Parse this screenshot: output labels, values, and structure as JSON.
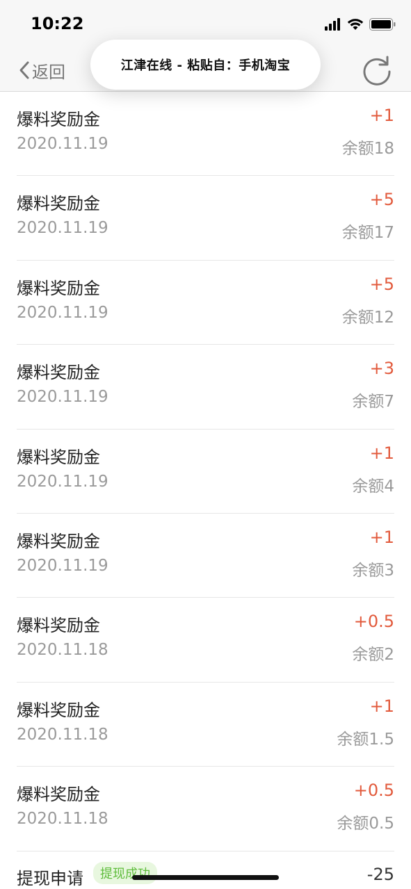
{
  "status_bar": {
    "time": "10:22"
  },
  "nav": {
    "back_label": "返回",
    "toast_text": "江津在线 - 粘贴自：手机淘宝"
  },
  "records": [
    {
      "title": "爆料奖励金",
      "date": "2020.11.19",
      "amount": "+1",
      "balance": "余额18"
    },
    {
      "title": "爆料奖励金",
      "date": "2020.11.19",
      "amount": "+5",
      "balance": "余额17"
    },
    {
      "title": "爆料奖励金",
      "date": "2020.11.19",
      "amount": "+5",
      "balance": "余额12"
    },
    {
      "title": "爆料奖励金",
      "date": "2020.11.19",
      "amount": "+3",
      "balance": "余额7"
    },
    {
      "title": "爆料奖励金",
      "date": "2020.11.19",
      "amount": "+1",
      "balance": "余额4"
    },
    {
      "title": "爆料奖励金",
      "date": "2020.11.19",
      "amount": "+1",
      "balance": "余额3"
    },
    {
      "title": "爆料奖励金",
      "date": "2020.11.18",
      "amount": "+0.5",
      "balance": "余额2"
    },
    {
      "title": "爆料奖励金",
      "date": "2020.11.18",
      "amount": "+1",
      "balance": "余额1.5"
    },
    {
      "title": "爆料奖励金",
      "date": "2020.11.18",
      "amount": "+0.5",
      "balance": "余额0.5"
    }
  ],
  "withdraw": {
    "title": "提现申请",
    "badge": "提现成功",
    "amount": "-25"
  },
  "colors": {
    "amount_positive": "#e25a3c",
    "badge_text": "#5fbd3c",
    "badge_bg": "#e8f7df"
  }
}
